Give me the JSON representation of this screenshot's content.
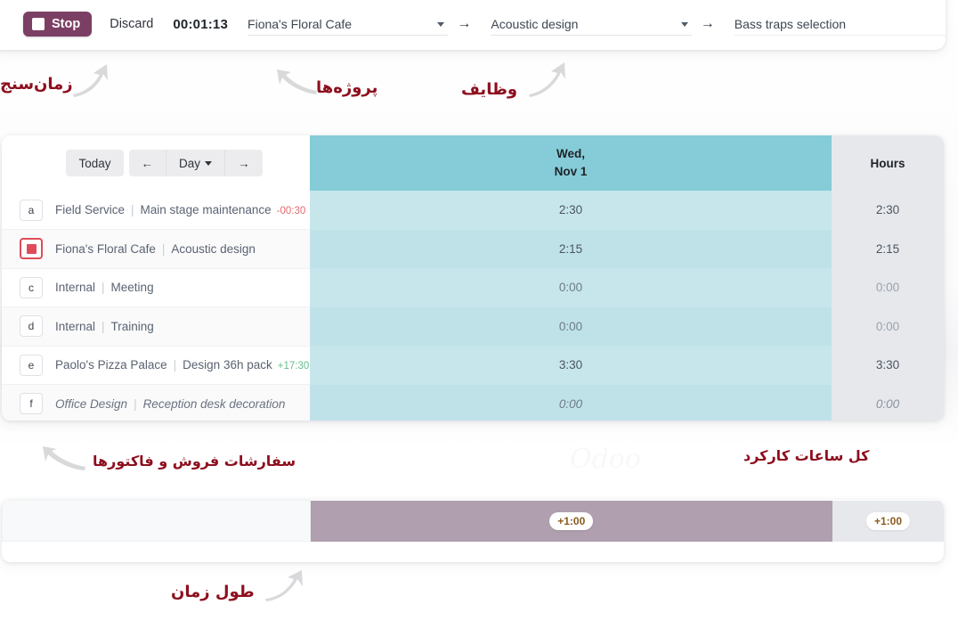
{
  "toolbar": {
    "stop_label": "Stop",
    "discard_label": "Discard",
    "timer": "00:01:13",
    "project_value": "Fiona's Floral Cafe",
    "task_value": "Acoustic design",
    "subtask_value": "Bass traps selection",
    "arrow_icon": "→",
    "accent_color": "#7c3f64"
  },
  "sheet": {
    "nav": {
      "today_label": "Today",
      "prev_label": "←",
      "scale_label": "Day",
      "next_label": "→"
    },
    "columns": {
      "day_line1": "Wed,",
      "day_line2": "Nov 1",
      "hours_label": "Hours"
    },
    "rows": [
      {
        "key": "a",
        "active": false,
        "italic": false,
        "project": "Field Service",
        "task": "Main stage maintenance",
        "delta": "-00:30",
        "delta_sign": "neg",
        "day": "2:30",
        "hours": "2:30",
        "zero": false
      },
      {
        "key": "b",
        "active": true,
        "italic": false,
        "project": "Fiona's Floral Cafe",
        "task": "Acoustic design",
        "delta": "",
        "delta_sign": "",
        "day": "2:15",
        "hours": "2:15",
        "zero": false
      },
      {
        "key": "c",
        "active": false,
        "italic": false,
        "project": "Internal",
        "task": "Meeting",
        "delta": "",
        "delta_sign": "",
        "day": "0:00",
        "hours": "0:00",
        "zero": true
      },
      {
        "key": "d",
        "active": false,
        "italic": false,
        "project": "Internal",
        "task": "Training",
        "delta": "",
        "delta_sign": "",
        "day": "0:00",
        "hours": "0:00",
        "zero": true
      },
      {
        "key": "e",
        "active": false,
        "italic": false,
        "project": "Paolo's Pizza Palace",
        "task": "Design 36h pack",
        "delta": "+17:30",
        "delta_sign": "pos",
        "day": "3:30",
        "hours": "3:30",
        "zero": false
      },
      {
        "key": "f",
        "active": false,
        "italic": true,
        "project": "Office Design",
        "task": "Reception desk decoration",
        "delta": "",
        "delta_sign": "",
        "day": "0:00",
        "hours": "0:00",
        "zero": true
      }
    ],
    "separator": "|",
    "header_color": "#85ccd8",
    "row_color": "#c6e6ec"
  },
  "summary": {
    "day_badge": "+1:00",
    "hours_badge": "+1:00",
    "bar_color": "#b09fae"
  },
  "annotations": {
    "timer": "زمان‌سنج",
    "projects": "پروژه‌ها",
    "tasks": "وظایف",
    "sales_orders": "سفارشات فروش و فاکتورها",
    "total_hours": "کل ساعات کارکرد",
    "duration": "طول زمان",
    "color": "#8d0f1e"
  }
}
